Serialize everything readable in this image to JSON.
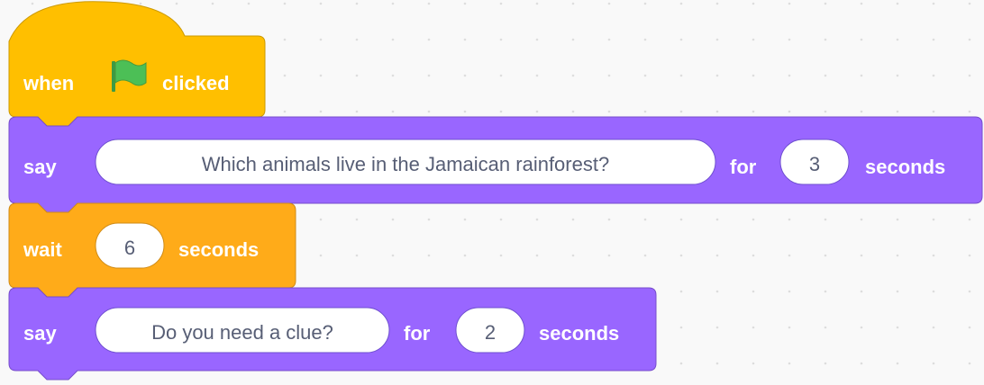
{
  "colors": {
    "workspace_bg": "#f9f9f9",
    "grid_dot": "#dddddd",
    "events": "#ffbf00",
    "events_border": "#cc9900",
    "looks": "#9966ff",
    "looks_border": "#774dcb",
    "control": "#ffab19",
    "control_border": "#cf8b17",
    "flag_icon": "#4cbf56",
    "input_text": "#575e75"
  },
  "blocks": [
    {
      "category": "events",
      "opcode": "when-flag-clicked",
      "text_before": "when",
      "icon": "green-flag-icon",
      "text_after": "clicked"
    },
    {
      "category": "looks",
      "opcode": "say-for-seconds",
      "keyword": "say",
      "message": "Which animals live in the Jamaican rainforest?",
      "for_label": "for",
      "secs": "3",
      "seconds_label": "seconds"
    },
    {
      "category": "control",
      "opcode": "wait-seconds",
      "keyword": "wait",
      "secs": "6",
      "seconds_label": "seconds"
    },
    {
      "category": "looks",
      "opcode": "say-for-seconds",
      "keyword": "say",
      "message": "Do you need a clue?",
      "for_label": "for",
      "secs": "2",
      "seconds_label": "seconds"
    }
  ]
}
